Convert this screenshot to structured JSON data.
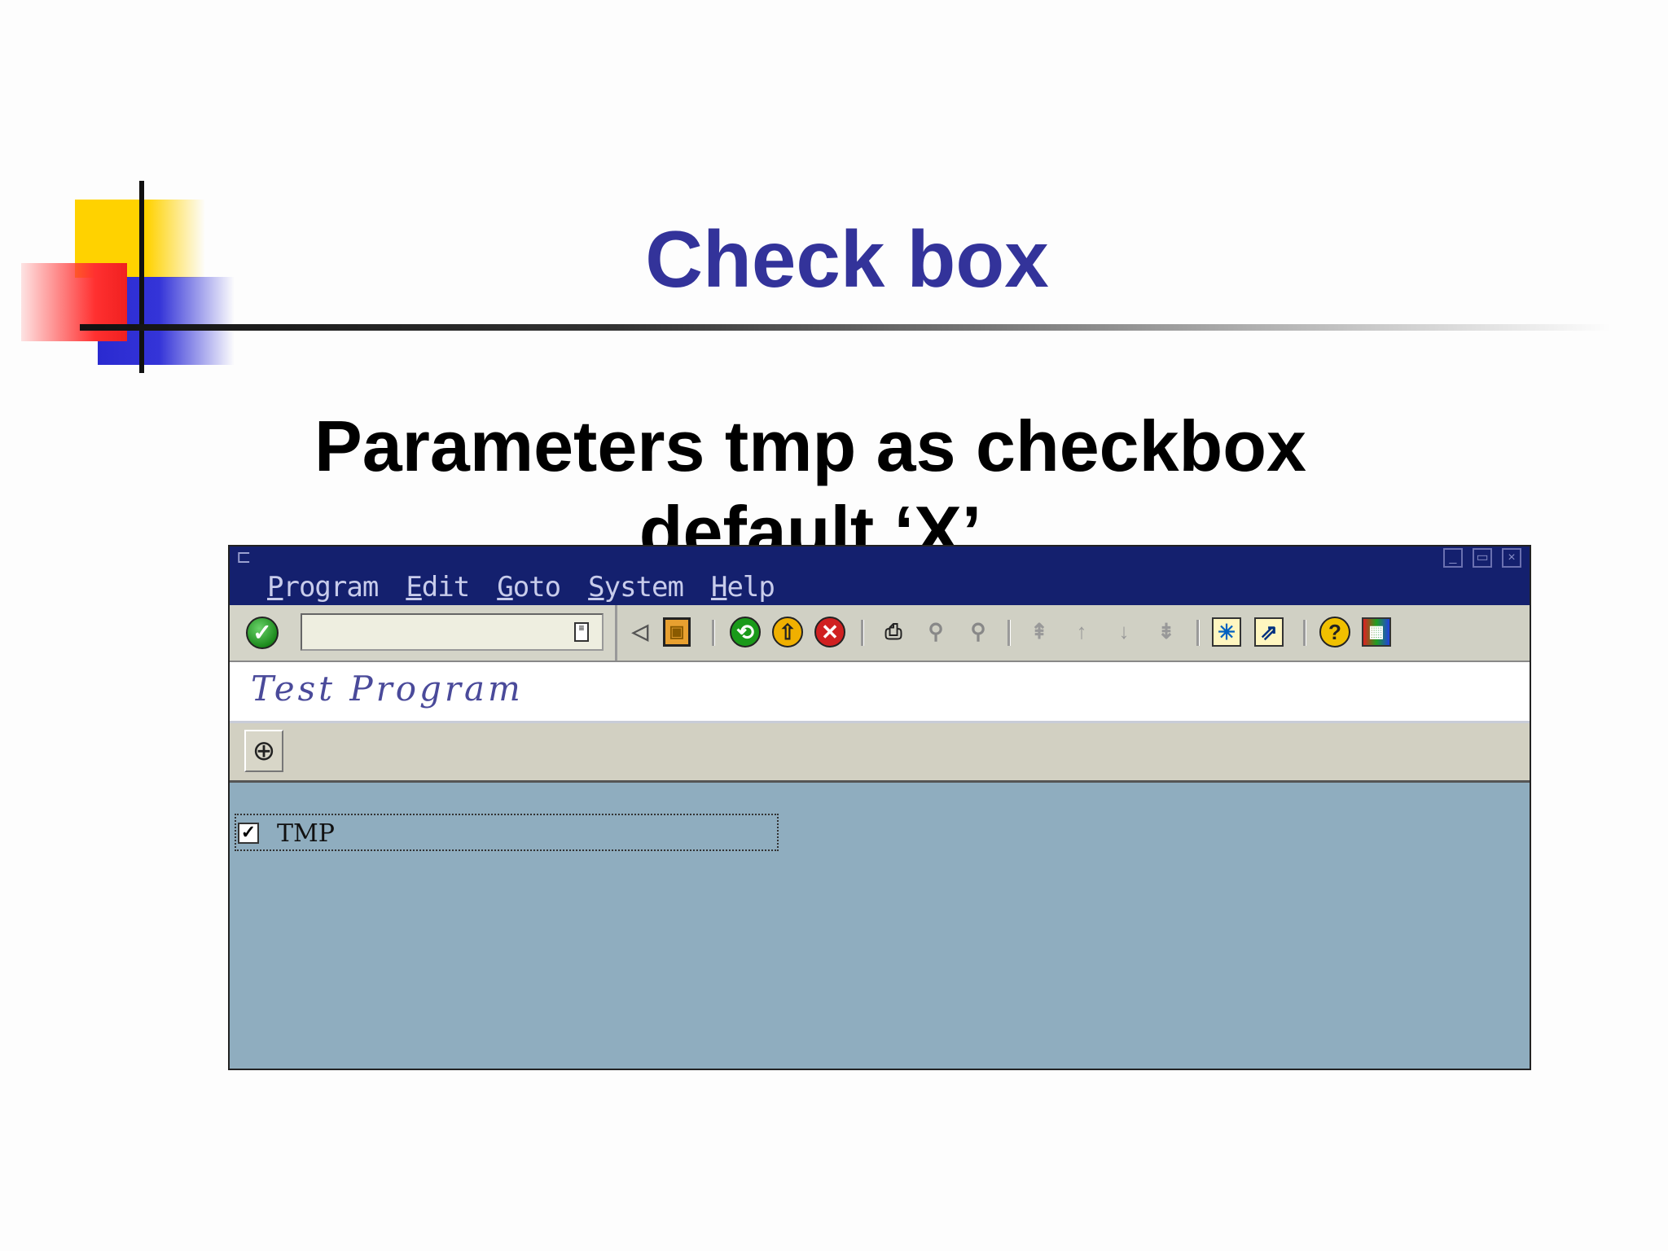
{
  "slide": {
    "title": "Check box",
    "body": "Parameters tmp as checkbox default ‘X’"
  },
  "sap": {
    "menu": [
      {
        "first": "P",
        "rest": "rogram"
      },
      {
        "first": "E",
        "rest": "dit"
      },
      {
        "first": "G",
        "rest": "oto"
      },
      {
        "first": "S",
        "rest": "ystem"
      },
      {
        "first": "H",
        "rest": "elp"
      }
    ],
    "command_field": {
      "value": "",
      "placeholder": ""
    },
    "program_title": "Test Program",
    "parameter": {
      "label": "TMP",
      "checked": true,
      "mark": "✓"
    },
    "icons": {
      "enter": "✓",
      "back": "◁",
      "save": "▣",
      "back_green": "⟲",
      "exit": "⇧",
      "cancel": "✕",
      "print": "⎙",
      "find": "⚲",
      "find_next": "⚲",
      "first_page": "⇞",
      "prev_page": "↑",
      "next_page": "↓",
      "last_page": "⇟",
      "new_session": "✳",
      "shortcut": "⇗",
      "help": "?",
      "layout": "▦",
      "execute": "⊕",
      "hist": "≡"
    },
    "colors": {
      "titlebar": "#14206e",
      "toolbar": "#d0d0c4",
      "screen": "#8fadbf",
      "slide_title": "#33339a"
    }
  }
}
